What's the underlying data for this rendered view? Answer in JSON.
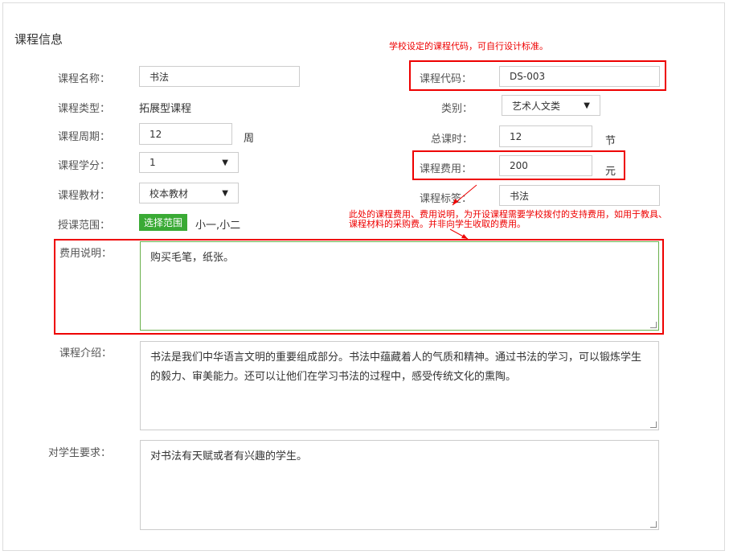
{
  "section_title": "课程信息",
  "annotations": {
    "code_note": "学校设定的课程代码，可自行设计标准。",
    "fee_note_line1": "此处的课程费用、费用说明，为开设课程需要学校拨付的支持费用，如用于教具、",
    "fee_note_line2": "课程材料的采购费。并非向学生收取的费用。"
  },
  "fields": {
    "course_name": {
      "label": "课程名称：",
      "value": "书法"
    },
    "course_code": {
      "label": "课程代码：",
      "value": "DS-003"
    },
    "course_type": {
      "label": "课程类型：",
      "value": "拓展型课程"
    },
    "category": {
      "label": "类别：",
      "value": "艺术人文类"
    },
    "period": {
      "label": "课程周期：",
      "value": "12",
      "unit": "周"
    },
    "total_hours": {
      "label": "总课时：",
      "value": "12",
      "unit": "节"
    },
    "credits": {
      "label": "课程学分：",
      "value": "1"
    },
    "fee": {
      "label": "课程费用：",
      "value": "200",
      "unit": "元"
    },
    "textbook": {
      "label": "课程教材：",
      "value": "校本教材"
    },
    "tag": {
      "label": "课程标签：",
      "value": "书法"
    },
    "scope": {
      "label": "授课范围：",
      "button": "选择范围",
      "value": "小一,小二"
    },
    "fee_desc": {
      "label": "费用说明：",
      "value": "购买毛笔，纸张。"
    },
    "intro": {
      "label": "课程介绍：",
      "value": "书法是我们中华语言文明的重要组成部分。书法中蕴藏着人的气质和精神。通过书法的学习，可以锻炼学生的毅力、审美能力。还可以让他们在学习书法的过程中，感受传统文化的熏陶。"
    },
    "requirement": {
      "label": "对学生要求：",
      "value": "对书法有天赋或者有兴趣的学生。"
    }
  },
  "colors": {
    "annotation_red": "#e00000",
    "button_green": "#3aaa35",
    "focus_green": "#6ab04c"
  }
}
